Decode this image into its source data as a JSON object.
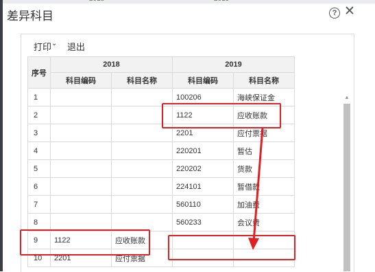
{
  "background_title": {
    "col1": "2018",
    "col2": "2019"
  },
  "dialog": {
    "title": "差异科目",
    "help_glyph": "?",
    "close_glyph": "✕"
  },
  "toolbar": {
    "print_label": "打印",
    "print_chevron": "⌄",
    "exit_label": "退出"
  },
  "table": {
    "header": {
      "index": "序号",
      "group_2018": "2018",
      "group_2019": "2019",
      "code": "科目编码",
      "name": "科目名称"
    },
    "rows": [
      {
        "idx": "1",
        "c18": "",
        "n18": "",
        "c19": "100206",
        "n19": "海峡保证金"
      },
      {
        "idx": "2",
        "c18": "",
        "n18": "",
        "c19": "1122",
        "n19": "应收账款"
      },
      {
        "idx": "3",
        "c18": "",
        "n18": "",
        "c19": "2201",
        "n19": "应付票据"
      },
      {
        "idx": "4",
        "c18": "",
        "n18": "",
        "c19": "220201",
        "n19": "暂估"
      },
      {
        "idx": "5",
        "c18": "",
        "n18": "",
        "c19": "220202",
        "n19": "货款"
      },
      {
        "idx": "6",
        "c18": "",
        "n18": "",
        "c19": "224101",
        "n19": "暂借款"
      },
      {
        "idx": "7",
        "c18": "",
        "n18": "",
        "c19": "560110",
        "n19": "加油费"
      },
      {
        "idx": "8",
        "c18": "",
        "n18": "",
        "c19": "560233",
        "n19": "会议费"
      },
      {
        "idx": "9",
        "c18": "1122",
        "n18": "应收账款",
        "c19": "",
        "n19": ""
      },
      {
        "idx": "10",
        "c18": "2201",
        "n18": "应付票据",
        "c19": "",
        "n19": ""
      }
    ]
  },
  "annotation": {
    "color": "#e02020"
  }
}
